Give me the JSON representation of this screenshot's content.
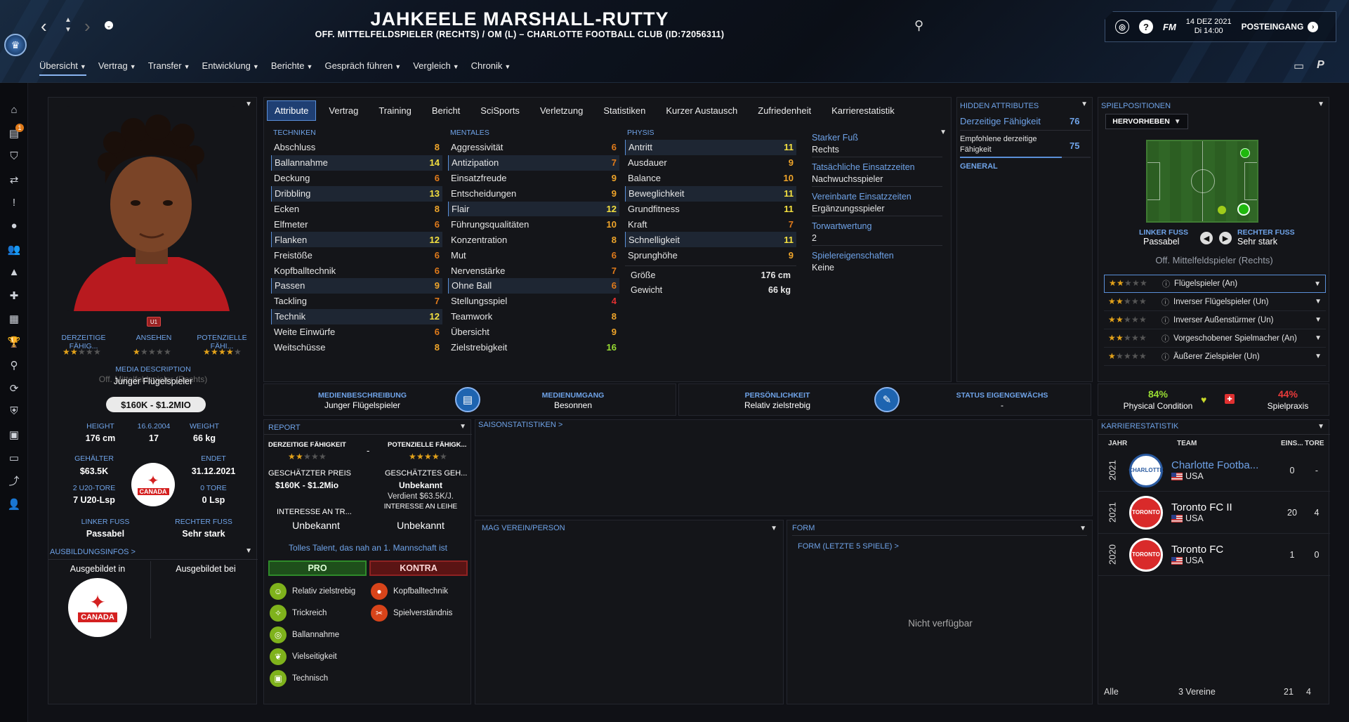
{
  "header": {
    "name": "JAHKEELE MARSHALL-RUTTY",
    "subtitle": "OFF. MITTELFELDSPIELER (RECHTS) / OM (L) – CHARLOTTE FOOTBALL CLUB (ID:72056311)",
    "date_line1": "14 DEZ 2021",
    "date_line2": "Di 14:00",
    "fm_label": "FM",
    "inbox_label": "POSTEINGANG",
    "help_glyph": "?"
  },
  "nav": [
    "Übersicht",
    "Vertrag",
    "Transfer",
    "Entwicklung",
    "Berichte",
    "Gespräch führen",
    "Vergleich",
    "Chronik"
  ],
  "sidebar_badge": "1",
  "profile": {
    "u_badge": "U1",
    "current_ability_label": "DERZEITIGE FÄHIG...",
    "reputation_label": "ANSEHEN",
    "potential_label": "POTENZIELLE FÄHI...",
    "current_ability_stars": 2,
    "reputation_stars": 1,
    "potential_stars": 4,
    "media_description_label": "MEDIA DESCRIPTION",
    "media_description_overlap": "Off. Mittelfeldspieler (Rechts)",
    "media_description_value": "Junger Flügelspieler",
    "value_range": "$160K - $1.2MIO",
    "height_label": "HEIGHT",
    "height_value": "176 cm",
    "dob_label": "16.6.2004",
    "age_value": "17",
    "weight_label": "WEIGHT",
    "weight_value": "66 kg",
    "salary_label": "GEHÄLTER",
    "salary_value": "$63.5K",
    "ends_label": "ENDET",
    "ends_value": "31.12.2021",
    "u20_goals_label": "2 U20-TORE",
    "u20_apps": "7 U20-Lsp",
    "goals_label": "0 TORE",
    "apps": "0 Lsp",
    "national_crest_text": "CANADA",
    "left_foot_label": "LINKER FUSS",
    "left_foot_value": "Passabel",
    "right_foot_label": "RECHTER FUSS",
    "right_foot_value": "Sehr stark",
    "training_info_label": "AUSBILDUNGSINFOS >",
    "trained_in_label": "Ausgebildet in",
    "trained_at_label": "Ausgebildet bei"
  },
  "tabs": [
    "Attribute",
    "Vertrag",
    "Training",
    "Bericht",
    "SciSports",
    "Verletzung",
    "Statistiken",
    "Kurzer Austausch",
    "Zufriedenheit",
    "Karrierestatistik"
  ],
  "attributes": {
    "technical_title": "TECHNIKEN",
    "technical": [
      {
        "name": "Abschluss",
        "value": 8,
        "hl": false
      },
      {
        "name": "Ballannahme",
        "value": 14,
        "hl": true
      },
      {
        "name": "Deckung",
        "value": 6,
        "hl": false
      },
      {
        "name": "Dribbling",
        "value": 13,
        "hl": true
      },
      {
        "name": "Ecken",
        "value": 8,
        "hl": false
      },
      {
        "name": "Elfmeter",
        "value": 6,
        "hl": false
      },
      {
        "name": "Flanken",
        "value": 12,
        "hl": true
      },
      {
        "name": "Freistöße",
        "value": 6,
        "hl": false
      },
      {
        "name": "Kopfballtechnik",
        "value": 6,
        "hl": false
      },
      {
        "name": "Passen",
        "value": 9,
        "hl": true
      },
      {
        "name": "Tackling",
        "value": 7,
        "hl": false
      },
      {
        "name": "Technik",
        "value": 12,
        "hl": true
      },
      {
        "name": "Weite Einwürfe",
        "value": 6,
        "hl": false
      },
      {
        "name": "Weitschüsse",
        "value": 8,
        "hl": false
      }
    ],
    "mental_title": "MENTALES",
    "mental": [
      {
        "name": "Aggressivität",
        "value": 6,
        "hl": false
      },
      {
        "name": "Antizipation",
        "value": 7,
        "hl": true
      },
      {
        "name": "Einsatzfreude",
        "value": 9,
        "hl": false
      },
      {
        "name": "Entscheidungen",
        "value": 9,
        "hl": false
      },
      {
        "name": "Flair",
        "value": 12,
        "hl": true
      },
      {
        "name": "Führungsqualitäten",
        "value": 10,
        "hl": false
      },
      {
        "name": "Konzentration",
        "value": 8,
        "hl": false
      },
      {
        "name": "Mut",
        "value": 6,
        "hl": false
      },
      {
        "name": "Nervenstärke",
        "value": 7,
        "hl": false
      },
      {
        "name": "Ohne Ball",
        "value": 6,
        "hl": true
      },
      {
        "name": "Stellungsspiel",
        "value": 4,
        "hl": false
      },
      {
        "name": "Teamwork",
        "value": 8,
        "hl": false
      },
      {
        "name": "Übersicht",
        "value": 9,
        "hl": false
      },
      {
        "name": "Zielstrebigkeit",
        "value": 16,
        "hl": false
      }
    ],
    "physical_title": "PHYSIS",
    "physical": [
      {
        "name": "Antritt",
        "value": 11,
        "hl": true
      },
      {
        "name": "Ausdauer",
        "value": 9,
        "hl": false
      },
      {
        "name": "Balance",
        "value": 10,
        "hl": false
      },
      {
        "name": "Beweglichkeit",
        "value": 11,
        "hl": true
      },
      {
        "name": "Grundfitness",
        "value": 11,
        "hl": false
      },
      {
        "name": "Kraft",
        "value": 7,
        "hl": false
      },
      {
        "name": "Schnelligkeit",
        "value": 11,
        "hl": true
      },
      {
        "name": "Sprunghöhe",
        "value": 9,
        "hl": false
      }
    ],
    "height_label": "Größe",
    "height_value": "176 cm",
    "weight_label": "Gewicht",
    "weight_value": "66 kg"
  },
  "info": [
    {
      "k": "Starker Fuß",
      "v": "Rechts"
    },
    {
      "k": "Tatsächliche Einsatzzeiten",
      "v": "Nachwuchsspieler"
    },
    {
      "k": "Vereinbarte Einsatzzeiten",
      "v": "Ergänzungsspieler"
    },
    {
      "k": "Torwartwertung",
      "v": "2"
    },
    {
      "k": "Spielereigenschaften",
      "v": "Keine"
    }
  ],
  "hidden": {
    "title": "HIDDEN ATTRIBUTES",
    "current_label": "Derzeitige Fähigkeit",
    "current_value": "76",
    "recommended_label": "Empfohlene derzeitige Fähigkeit",
    "recommended_value": "75",
    "general_label": "GENERAL"
  },
  "positions": {
    "title": "SPIELPOSITIONEN",
    "highlight_btn": "HERVORHEBEN",
    "left_foot_label": "LINKER FUSS",
    "left_foot_value": "Passabel",
    "right_foot_label": "RECHTER FUSS",
    "right_foot_value": "Sehr stark",
    "main_position": "Off. Mittelfeldspieler (Rechts)",
    "roles": [
      {
        "name": "Flügelspieler (An)",
        "stars": 2.0,
        "selected": true
      },
      {
        "name": "Inverser Flügelspieler (Un)",
        "stars": 1.5,
        "selected": false
      },
      {
        "name": "Inverser Außenstürmer (Un)",
        "stars": 1.5,
        "selected": false
      },
      {
        "name": "Vorgeschobener Spielmacher (An)",
        "stars": 1.5,
        "selected": false
      },
      {
        "name": "Äußerer Zielspieler (Un)",
        "stars": 1.0,
        "selected": false
      }
    ]
  },
  "strip": {
    "media_desc_label": "MEDIENBESCHREIBUNG",
    "media_desc_value": "Junger Flügelspieler",
    "media_handling_label": "MEDIENUMGANG",
    "media_handling_value": "Besonnen",
    "personality_label": "PERSÖNLICHKEIT",
    "personality_value": "Relativ zielstrebig",
    "homegrown_label": "STATUS EIGENGEWÄCHS",
    "homegrown_value": "-",
    "condition_value": "84%",
    "condition_label": "Physical Condition",
    "match_practice_value": "44%",
    "match_practice_label": "Spielpraxis"
  },
  "report": {
    "title": "REPORT",
    "current_label": "DERZEITIGE FÄHIGKEIT",
    "potential_label": "POTENZIELLE FÄHIGK...",
    "dash": "-",
    "current_stars": 2,
    "potential_stars": 4,
    "price_label": "GESCHÄTZTER PREIS",
    "price_value": "$160K - $1.2Mio",
    "salary_label": "GESCHÄTZTES GEH...",
    "salary_value": "Unbekannt",
    "earns": "Verdient $63.5K/J.",
    "interest1_label": "INTERESSE AN TR...",
    "interest1_value": "Unbekannt",
    "interest2_label": "INTERESSE AN LEIHE",
    "interest2_value": "Unbekannt",
    "verdict": "Tolles Talent, das nah an 1. Mannschaft ist",
    "pro_label": "PRO",
    "con_label": "KONTRA",
    "pros": [
      "Relativ zielstrebig",
      "Trickreich",
      "Ballannahme",
      "Vielseitigkeit",
      "Technisch"
    ],
    "cons": [
      "Kopfballtechnik",
      "Spielverständnis"
    ]
  },
  "season_stats_label": "SAISONSTATISTIKEN >",
  "likes_label": "MAG VEREIN/PERSON",
  "form": {
    "title": "FORM",
    "sub": "FORM (LETZTE 5 SPIELE) >",
    "na": "Nicht verfügbar"
  },
  "career": {
    "title": "KARRIERESTATISTIK",
    "cols": [
      "JAHR",
      "TEAM",
      "EINS...",
      "TORE"
    ],
    "rows": [
      {
        "year": "2021",
        "team": "Charlotte Footba...",
        "nation": "USA",
        "apps": "0",
        "goals": "-",
        "crest": "CHARLOTTE"
      },
      {
        "year": "2021",
        "team": "Toronto FC II",
        "nation": "USA",
        "apps": "20",
        "goals": "4",
        "crest": "TORONTO"
      },
      {
        "year": "2020",
        "team": "Toronto FC",
        "nation": "USA",
        "apps": "1",
        "goals": "0",
        "crest": "TORONTO"
      }
    ],
    "total_label": "Alle",
    "total_clubs": "3 Vereine",
    "total_apps": "21",
    "total_goals": "4"
  }
}
